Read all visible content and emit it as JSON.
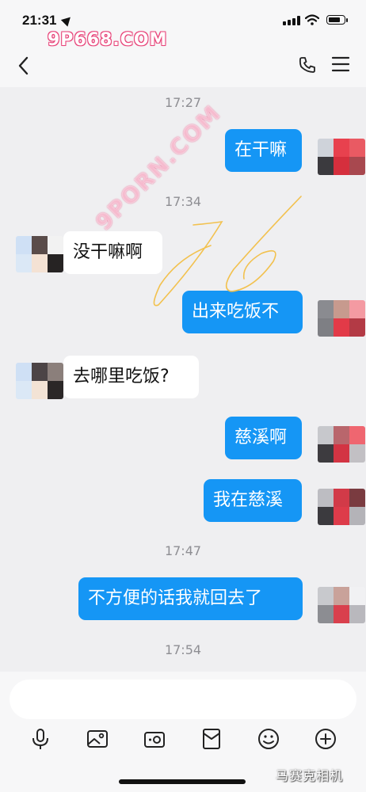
{
  "status_bar": {
    "time": "21:31"
  },
  "watermarks": {
    "top": "9P668.COM",
    "diagonal": "9PORN.COM",
    "bottom": "马赛克相机"
  },
  "timestamps": [
    "17:27",
    "17:34",
    "17:47",
    "17:54"
  ],
  "messages": [
    {
      "side": "out",
      "text": "在干嘛"
    },
    {
      "side": "in",
      "text": "没干嘛啊"
    },
    {
      "side": "out",
      "text": "出来吃饭不"
    },
    {
      "side": "in",
      "text": "去哪里吃饭?"
    },
    {
      "side": "out",
      "text": "慈溪啊"
    },
    {
      "side": "out",
      "text": "我在慈溪"
    },
    {
      "side": "out",
      "text": "不方便的话我就回去了"
    }
  ],
  "composer": {
    "value": "",
    "placeholder": ""
  },
  "toolbar_icons": [
    "microphone-icon",
    "image-icon",
    "camera-icon",
    "red-packet-icon",
    "emoji-icon",
    "plus-icon"
  ],
  "colors": {
    "outgoing_bubble": "#1596f5",
    "incoming_bubble": "#ffffff",
    "background": "#efeff1",
    "scribble": "#f2c14e"
  }
}
